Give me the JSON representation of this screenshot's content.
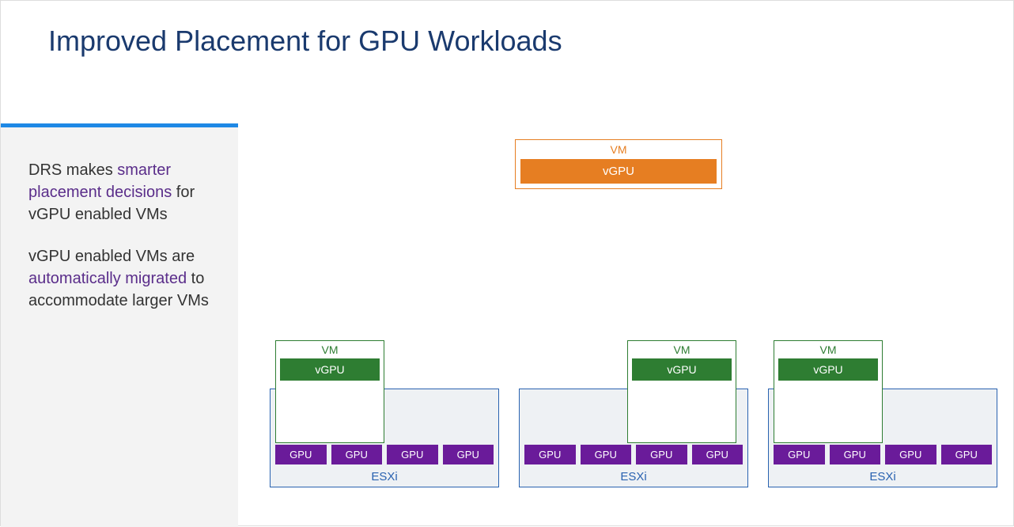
{
  "title": "Improved Placement for GPU Workloads",
  "sidebar": {
    "p1_a": "DRS makes ",
    "p1_h": "smarter placement decisions",
    "p1_b": " for vGPU enabled VMs",
    "p2_a": "vGPU enabled VMs are ",
    "p2_h": "automatically migrated",
    "p2_b": " to accommodate larger VMs"
  },
  "labels": {
    "vm": "VM",
    "vgpu": "vGPU",
    "gpu": "GPU",
    "esxi": "ESXi"
  },
  "colors": {
    "title": "#1a3a6e",
    "accent": "#1e88e5",
    "highlight": "#5a2d8a",
    "orange": "#e67e22",
    "green": "#2e7d32",
    "purple": "#6a1b9a",
    "blue": "#2962b0"
  },
  "hosts": [
    {
      "id": "host-a",
      "gpus": 4,
      "vm_slot": "left"
    },
    {
      "id": "host-b",
      "gpus": 4,
      "vm_slot": "right"
    },
    {
      "id": "host-c",
      "gpus": 4,
      "vm_slot": "left"
    }
  ]
}
